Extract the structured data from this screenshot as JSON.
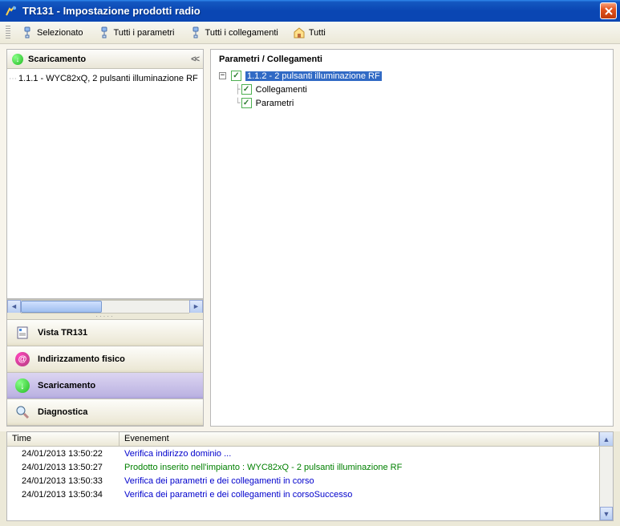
{
  "window": {
    "title": "TR131 - Impostazione prodotti radio"
  },
  "toolbar": {
    "selected": "Selezionato",
    "all_params": "Tutti i parametri",
    "all_links": "Tutti i collegamenti",
    "all": "Tutti"
  },
  "sidebar": {
    "header_title": "Scaricamento",
    "collapse_label": "<<",
    "tree_item": "1.1.1 - WYC82xQ, 2 pulsanti illuminazione RF",
    "nav": {
      "view": "Vista TR131",
      "addressing": "Indirizzamento fisico",
      "download": "Scaricamento",
      "diagnostic": "Diagnostica"
    }
  },
  "main_panel": {
    "heading": "Parametri / Collegamenti",
    "root_node": "1.1.2 - 2 pulsanti illuminazione RF",
    "child_links": "Collegamenti",
    "child_params": "Parametri"
  },
  "log": {
    "col_time": "Time",
    "col_event": "Evenement",
    "rows": [
      {
        "time": "24/01/2013 13:50:22",
        "text": "Verifica indirizzo dominio ...",
        "cls": "t-blue"
      },
      {
        "time": "24/01/2013 13:50:27",
        "text": "Prodotto inserito nell'impianto : WYC82xQ - 2 pulsanti illuminazione RF",
        "cls": "t-green"
      },
      {
        "time": "24/01/2013 13:50:33",
        "text": "Verifica dei parametri e dei collegamenti in corso",
        "cls": "t-blue"
      },
      {
        "time": "24/01/2013 13:50:34",
        "text": "Verifica dei parametri e dei collegamenti in corsoSuccesso",
        "cls": "t-blue"
      }
    ]
  }
}
